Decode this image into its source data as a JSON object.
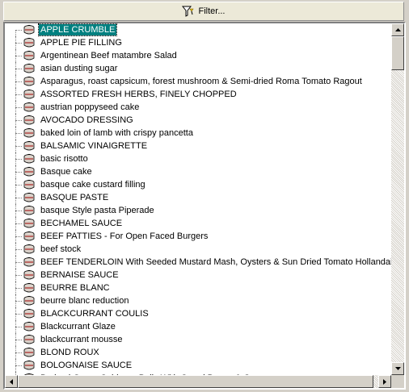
{
  "toolbar": {
    "filter_label": "Filter..."
  },
  "tree": {
    "items": [
      {
        "label": "APPLE CRUMBLE",
        "selected": true
      },
      {
        "label": "APPLE PIE FILLING"
      },
      {
        "label": "Argentinean Beef matambre Salad"
      },
      {
        "label": "asian dusting sugar"
      },
      {
        "label": "Asparagus, roast capsicum, forest mushroom & Semi-dried Roma Tomato Ragout"
      },
      {
        "label": "ASSORTED FRESH HERBS, FINELY CHOPPED"
      },
      {
        "label": "austrian poppyseed cake"
      },
      {
        "label": "AVOCADO DRESSING"
      },
      {
        "label": "baked loin of lamb with crispy pancetta"
      },
      {
        "label": "BALSAMIC VINAIGRETTE"
      },
      {
        "label": "basic risotto"
      },
      {
        "label": "Basque cake"
      },
      {
        "label": "basque cake custard filling"
      },
      {
        "label": "BASQUE PASTE"
      },
      {
        "label": "basque Style pasta Piperade"
      },
      {
        "label": "BECHAMEL SAUCE"
      },
      {
        "label": "BEEF PATTIES - For Open Faced Burgers"
      },
      {
        "label": "beef stock"
      },
      {
        "label": "BEEF TENDERLOIN With Seeded Mustard Mash, Oysters &  Sun Dried Tomato Hollandaise"
      },
      {
        "label": "BERNAISE SAUCE"
      },
      {
        "label": "BEURRE BLANC"
      },
      {
        "label": "beurre blanc reduction"
      },
      {
        "label": "BLACKCURRANT COULIS"
      },
      {
        "label": "Blackcurrant Glaze"
      },
      {
        "label": "blackcurrant mousse"
      },
      {
        "label": "BLOND ROUX"
      },
      {
        "label": "BOLOGNAISE SAUCE"
      },
      {
        "label": "Braised Green Cabbage Balls With Cured Bacon & Caraway"
      }
    ]
  },
  "icons": {
    "item": "recipe-pot-icon",
    "filter": "filter-funnel-icon"
  }
}
